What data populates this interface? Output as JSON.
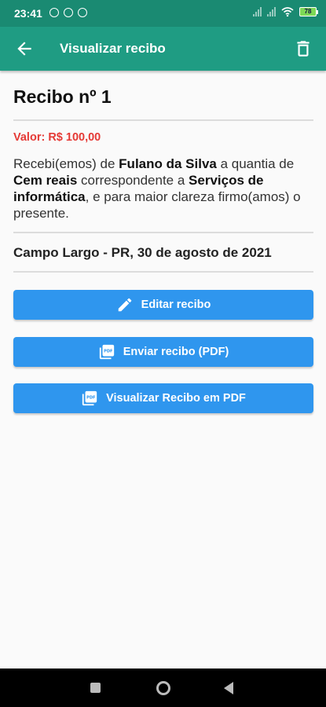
{
  "status_bar": {
    "time": "23:41",
    "battery": "78"
  },
  "app_bar": {
    "title": "Visualizar recibo"
  },
  "receipt": {
    "heading": "Recibo nº 1",
    "valor": "Valor: R$ 100,00",
    "text": {
      "t1": "Recebi(emos) de ",
      "payer": "Fulano da Silva",
      "t2": " a quantia de ",
      "amount_words": "Cem reais",
      "t3": " correspondente a ",
      "service": "Serviços de informática",
      "t4": ", e para maior clareza firmo(amos) o presente."
    },
    "place_date": "Campo Largo - PR, 30 de agosto de 2021"
  },
  "buttons": {
    "edit": "Editar recibo",
    "send": "Enviar recibo (PDF)",
    "view": "Visualizar Recibo em PDF"
  },
  "colors": {
    "appbar": "#1f9c83",
    "statusbar": "#1a8a72",
    "button": "#2f96ee",
    "valor": "#e53935"
  }
}
